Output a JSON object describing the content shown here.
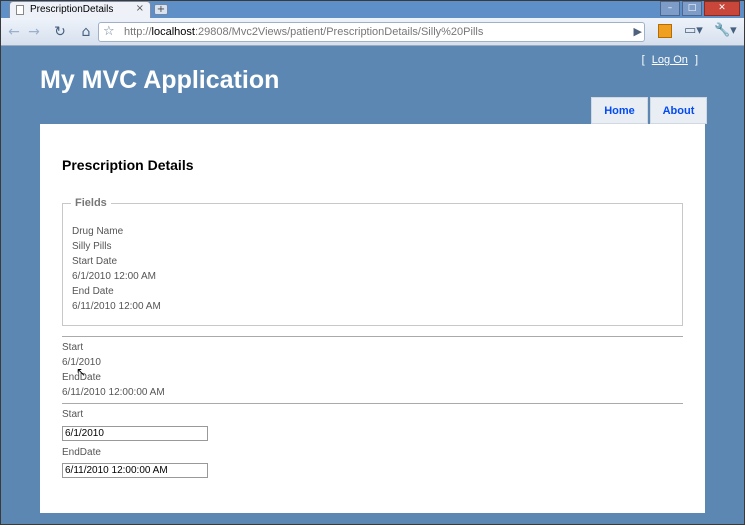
{
  "browser": {
    "tab_title": "PrescriptionDetails",
    "tab_close": "×",
    "new_tab": "+",
    "url_prefix": "http://",
    "url_host": "localhost",
    "url_rest": ":29808/Mvc2Views/patient/PrescriptionDetails/Silly%20Pills"
  },
  "header": {
    "login_left": "[",
    "login_link": "Log On",
    "login_right": "]",
    "site_title": "My MVC Application",
    "menu": [
      "Home",
      "About"
    ]
  },
  "main": {
    "heading": "Prescription Details",
    "fieldset_legend": "Fields",
    "fields": {
      "drug_name_label": "Drug Name",
      "drug_name_value": "Silly Pills",
      "start_date_label": "Start Date",
      "start_date_value": "6/1/2010 12:00 AM",
      "end_date_label": "End Date",
      "end_date_value": "6/11/2010 12:00 AM"
    },
    "plain": {
      "start_label": "Start",
      "start_value": "6/1/2010",
      "end_label": "EndDate",
      "end_value": "6/11/2010 12:00:00 AM"
    },
    "editor": {
      "start_label": "Start",
      "start_value": "6/1/2010",
      "end_label": "EndDate",
      "end_value": "6/11/2010 12:00:00 AM"
    }
  },
  "colors": {
    "page_bg": "#5c87b2",
    "menu_text": "#034af3"
  }
}
